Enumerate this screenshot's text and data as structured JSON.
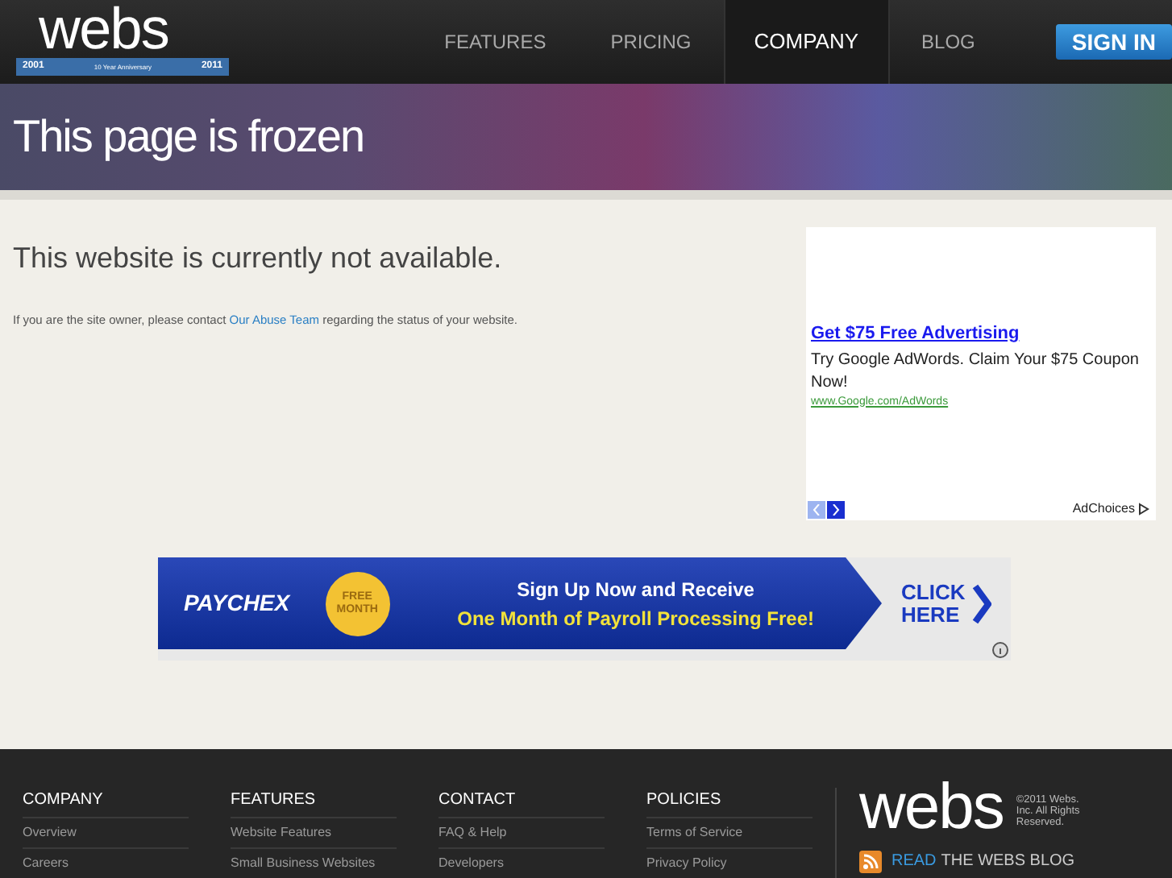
{
  "header": {
    "logo": {
      "wordmark": "webs",
      "ribbon_start": "2001",
      "ribbon_middle": "10 Year Anniversary",
      "ribbon_end": "2011"
    },
    "nav": [
      {
        "label": "FEATURES",
        "selected": false
      },
      {
        "label": "PRICING",
        "selected": false
      },
      {
        "label": "COMPANY",
        "selected": true
      },
      {
        "label": "BLOG",
        "selected": false
      }
    ],
    "sign_in": "SIGN IN"
  },
  "banner": {
    "title": "This page is frozen"
  },
  "main": {
    "heading": "This website is currently not available.",
    "message_before": "If you are the site owner, please contact",
    "message_link": "Our Abuse Team",
    "message_after": "regarding the status of your website."
  },
  "text_ad": {
    "title": "Get $75 Free Advertising",
    "body": "Try Google AdWords. Claim Your $75 Coupon Now!",
    "url": "www.Google.com/AdWords",
    "ad_choices": "AdChoices"
  },
  "banner_ad": {
    "brand": "PAYCHEX",
    "seal": "FREE MONTH",
    "line_1": "Sign Up Now and Receive",
    "line_2": "One Month of Payroll Processing Free!",
    "cta": "CLICK HERE"
  },
  "footer": {
    "columns": [
      {
        "heading": "COMPANY",
        "links": [
          "Overview",
          "Careers"
        ]
      },
      {
        "heading": "FEATURES",
        "links": [
          "Website Features",
          "Small Business Websites"
        ]
      },
      {
        "heading": "CONTACT",
        "links": [
          "FAQ & Help",
          "Developers"
        ]
      },
      {
        "heading": "POLICIES",
        "links": [
          "Terms of Service",
          "Privacy Policy"
        ]
      }
    ],
    "wordmark": "webs",
    "copyright": "©2011 Webs. Inc. All Rights Reserved.",
    "blog_read": "READ",
    "blog_rest": "THE WEBS BLOG"
  }
}
